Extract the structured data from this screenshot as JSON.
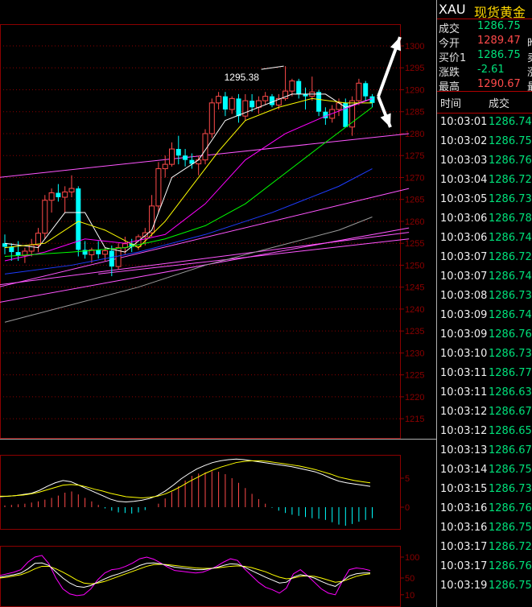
{
  "colors": {
    "background": "#000000",
    "grid": "#8b0000",
    "up": "#ff4a4a",
    "down": "#00ffff",
    "green_text": "#00e07a",
    "red_text": "#ff4a4a",
    "yellow_text": "#ffd700",
    "ma5": "#ffffff",
    "ma10": "#ffff00",
    "ma20": "#ff00ff",
    "ma30": "#00ff00",
    "ma60": "#1e3cff",
    "ma120": "#9a9a9a",
    "trend": "#ff55ff"
  },
  "header": {
    "symbol": "XAU",
    "name": "现货黄金"
  },
  "quote": [
    {
      "label": "成交",
      "value": "1286.75",
      "color": "#00e07a",
      "extra": ""
    },
    {
      "label": "今开",
      "value": "1289.47",
      "color": "#ff4a4a",
      "extra": "昨"
    },
    {
      "label": "买价1",
      "value": "1286.75",
      "color": "#00e07a",
      "extra": "卖"
    },
    {
      "label": "涨跌",
      "value": "-2.61",
      "color": "#00e07a",
      "extra": "涨"
    },
    {
      "label": "最高",
      "value": "1290.67",
      "color": "#ff4a4a",
      "extra": "最"
    }
  ],
  "ticks_header": {
    "time": "时间",
    "price": "成交"
  },
  "ticks": [
    {
      "time": "10:03:01",
      "price": "1286.74"
    },
    {
      "time": "10:03:02",
      "price": "1286.75"
    },
    {
      "time": "10:03:03",
      "price": "1286.76"
    },
    {
      "time": "10:03:04",
      "price": "1286.72"
    },
    {
      "time": "10:03:05",
      "price": "1286.73"
    },
    {
      "time": "10:03:06",
      "price": "1286.78"
    },
    {
      "time": "10:03:06",
      "price": "1286.74"
    },
    {
      "time": "10:03:07",
      "price": "1286.72"
    },
    {
      "time": "10:03:07",
      "price": "1286.74"
    },
    {
      "time": "10:03:08",
      "price": "1286.73"
    },
    {
      "time": "10:03:09",
      "price": "1286.74"
    },
    {
      "time": "10:03:09",
      "price": "1286.76"
    },
    {
      "time": "10:03:10",
      "price": "1286.73"
    },
    {
      "time": "10:03:11",
      "price": "1286.77"
    },
    {
      "time": "10:03:11",
      "price": "1286.63"
    },
    {
      "time": "10:03:12",
      "price": "1286.67"
    },
    {
      "time": "10:03:12",
      "price": "1286.65"
    },
    {
      "time": "10:03:13",
      "price": "1286.67"
    },
    {
      "time": "10:03:14",
      "price": "1286.75"
    },
    {
      "time": "10:03:15",
      "price": "1286.73"
    },
    {
      "time": "10:03:16",
      "price": "1286.76"
    },
    {
      "time": "10:03:16",
      "price": "1286.75"
    },
    {
      "time": "10:03:17",
      "price": "1286.72"
    },
    {
      "time": "10:03:17",
      "price": "1286.76"
    },
    {
      "time": "10:03:19",
      "price": "1286.75"
    }
  ],
  "chart_data": [
    {
      "type": "candlestick",
      "ylim": [
        1212,
        1302
      ],
      "y_ticks": [
        "1300",
        "1295",
        "1290",
        "1285",
        "1280",
        "1275",
        "1270",
        "1265",
        "1260",
        "1255",
        "1250",
        "1245",
        "1240",
        "1235",
        "1230",
        "1225",
        "1220",
        "1215"
      ],
      "annotation": "1295.38",
      "candles": [
        [
          1255.0,
          1257.0,
          1252.5,
          1254.2
        ],
        [
          1254.2,
          1255.0,
          1251.0,
          1253.0
        ],
        [
          1253.0,
          1255.5,
          1251.0,
          1252.2
        ],
        [
          1252.2,
          1254.0,
          1250.5,
          1253.2
        ],
        [
          1253.2,
          1256.0,
          1252.0,
          1254.6
        ],
        [
          1254.6,
          1258.5,
          1253.0,
          1257.3
        ],
        [
          1257.3,
          1266.0,
          1256.0,
          1264.8
        ],
        [
          1264.8,
          1267.5,
          1262.0,
          1266.5
        ],
        [
          1266.5,
          1268.5,
          1264.5,
          1265.5
        ],
        [
          1265.5,
          1268.0,
          1262.0,
          1266.7
        ],
        [
          1266.7,
          1270.5,
          1265.5,
          1267.5
        ],
        [
          1267.5,
          1268.0,
          1252.0,
          1253.5
        ],
        [
          1253.5,
          1255.5,
          1251.5,
          1252.4
        ],
        [
          1252.4,
          1254.0,
          1250.5,
          1253.5
        ],
        [
          1253.5,
          1255.5,
          1251.5,
          1252.5
        ],
        [
          1252.5,
          1254.0,
          1251.0,
          1253.3
        ],
        [
          1253.3,
          1254.5,
          1247.5,
          1249.7
        ],
        [
          1249.7,
          1255.0,
          1249.0,
          1254.0
        ],
        [
          1254.0,
          1256.5,
          1252.5,
          1254.9
        ],
        [
          1254.9,
          1256.0,
          1253.0,
          1254.2
        ],
        [
          1254.2,
          1257.0,
          1253.5,
          1256.5
        ],
        [
          1256.5,
          1258.5,
          1254.5,
          1257.4
        ],
        [
          1257.4,
          1266.0,
          1256.5,
          1263.5
        ],
        [
          1263.5,
          1273.5,
          1262.0,
          1272.0
        ],
        [
          1272.0,
          1275.0,
          1270.0,
          1273.0
        ],
        [
          1273.0,
          1278.0,
          1272.5,
          1276.5
        ],
        [
          1276.5,
          1279.5,
          1273.0,
          1275.0
        ],
        [
          1275.0,
          1276.5,
          1272.5,
          1274.0
        ],
        [
          1274.0,
          1275.5,
          1272.0,
          1273.1
        ],
        [
          1273.1,
          1275.0,
          1270.5,
          1274.0
        ],
        [
          1274.0,
          1281.0,
          1273.0,
          1280.0
        ],
        [
          1280.0,
          1288.0,
          1279.0,
          1287.0
        ],
        [
          1287.0,
          1289.5,
          1285.5,
          1288.5
        ],
        [
          1288.5,
          1289.5,
          1284.0,
          1285.5
        ],
        [
          1285.5,
          1288.5,
          1284.5,
          1288.0
        ],
        [
          1288.0,
          1289.0,
          1282.5,
          1284.0
        ],
        [
          1284.0,
          1289.0,
          1283.0,
          1287.5
        ],
        [
          1287.5,
          1289.0,
          1285.0,
          1286.0
        ],
        [
          1286.0,
          1288.5,
          1284.5,
          1287.5
        ],
        [
          1287.5,
          1289.5,
          1286.5,
          1288.5
        ],
        [
          1288.5,
          1289.0,
          1286.0,
          1286.5
        ],
        [
          1286.5,
          1289.0,
          1285.5,
          1288.0
        ],
        [
          1288.0,
          1295.38,
          1287.5,
          1289.7
        ],
        [
          1289.7,
          1292.5,
          1288.5,
          1292.0
        ],
        [
          1292.0,
          1292.5,
          1288.0,
          1289.0
        ],
        [
          1289.0,
          1290.5,
          1285.5,
          1288.5
        ],
        [
          1288.5,
          1293.0,
          1287.5,
          1289.5
        ],
        [
          1289.5,
          1290.0,
          1284.0,
          1285.0
        ],
        [
          1285.0,
          1286.0,
          1282.0,
          1283.5
        ],
        [
          1283.5,
          1286.5,
          1282.5,
          1285.5
        ],
        [
          1285.5,
          1288.0,
          1284.0,
          1287.0
        ],
        [
          1287.0,
          1288.0,
          1282.0,
          1281.5
        ],
        [
          1281.5,
          1288.5,
          1279.5,
          1287.5
        ],
        [
          1287.5,
          1292.5,
          1286.5,
          1291.5
        ],
        [
          1291.5,
          1292.0,
          1287.5,
          1288.5
        ],
        [
          1288.5,
          1289.0,
          1286.0,
          1287.0
        ]
      ],
      "moving_averages": [
        {
          "name": "ma5",
          "color": "#ffffff",
          "points": [
            [
              0,
              1255
            ],
            [
              5,
              1254
            ],
            [
              9,
              1262
            ],
            [
              12,
              1262
            ],
            [
              15,
              1254
            ],
            [
              18,
              1253
            ],
            [
              22,
              1258
            ],
            [
              25,
              1270
            ],
            [
              29,
              1274
            ],
            [
              33,
              1283
            ],
            [
              38,
              1286
            ],
            [
              43,
              1289
            ],
            [
              48,
              1289
            ],
            [
              51,
              1286
            ],
            [
              55,
              1288
            ]
          ]
        },
        {
          "name": "ma10",
          "color": "#ffff00",
          "points": [
            [
              0,
              1254
            ],
            [
              6,
              1255
            ],
            [
              11,
              1260
            ],
            [
              15,
              1258
            ],
            [
              20,
              1254
            ],
            [
              24,
              1260
            ],
            [
              28,
              1268
            ],
            [
              32,
              1276
            ],
            [
              36,
              1283
            ],
            [
              41,
              1286
            ],
            [
              46,
              1288
            ],
            [
              51,
              1287
            ],
            [
              55,
              1287
            ]
          ]
        },
        {
          "name": "ma20",
          "color": "#ff00ff",
          "points": [
            [
              0,
              1251
            ],
            [
              6,
              1253
            ],
            [
              12,
              1256
            ],
            [
              18,
              1255
            ],
            [
              24,
              1257
            ],
            [
              30,
              1264
            ],
            [
              36,
              1274
            ],
            [
              42,
              1280
            ],
            [
              48,
              1284
            ],
            [
              55,
              1288
            ]
          ]
        },
        {
          "name": "ma30",
          "color": "#00ff00",
          "points": [
            [
              0,
              1252
            ],
            [
              10,
              1253
            ],
            [
              18,
              1254
            ],
            [
              24,
              1256
            ],
            [
              30,
              1259
            ],
            [
              36,
              1264
            ],
            [
              42,
              1271
            ],
            [
              48,
              1278
            ],
            [
              55,
              1286
            ]
          ]
        },
        {
          "name": "ma60",
          "color": "#1e3cff",
          "points": [
            [
              0,
              1248
            ],
            [
              10,
              1250
            ],
            [
              20,
              1253
            ],
            [
              30,
              1257
            ],
            [
              40,
              1262
            ],
            [
              50,
              1268
            ],
            [
              55,
              1272
            ]
          ]
        },
        {
          "name": "ma120",
          "color": "#9a9a9a",
          "points": [
            [
              0,
              1237
            ],
            [
              10,
              1241
            ],
            [
              20,
              1245
            ],
            [
              30,
              1250
            ],
            [
              40,
              1254
            ],
            [
              50,
              1258
            ],
            [
              55,
              1261
            ]
          ]
        }
      ],
      "trendlines": [
        [
          [
            -1,
            1270
          ],
          [
            60.5,
            1280
          ]
        ],
        [
          [
            -1,
            1245
          ],
          [
            60.5,
            1267.5
          ]
        ],
        [
          [
            -1,
            1241.5
          ],
          [
            60.5,
            1258.5
          ]
        ],
        [
          [
            -1,
            1245.5
          ],
          [
            60.5,
            1257.5
          ]
        ],
        [
          [
            14,
            1248
          ],
          [
            60.5,
            1256
          ]
        ]
      ]
    },
    {
      "type": "macd",
      "ylim": [
        -3,
        8
      ],
      "y_ticks": [
        "5",
        "0"
      ],
      "hist": [
        0.3,
        0.4,
        0.5,
        0.6,
        0.8,
        1.0,
        1.3,
        1.6,
        2.0,
        2.5,
        2.7,
        2.2,
        1.6,
        1.0,
        0.4,
        -0.2,
        -0.6,
        -0.9,
        -1.0,
        -1.1,
        -0.9,
        -0.5,
        0.0,
        0.6,
        1.5,
        2.6,
        3.6,
        4.6,
        5.4,
        5.8,
        6.0,
        6.2,
        6.1,
        5.7,
        5.0,
        4.2,
        3.3,
        2.3,
        1.4,
        0.6,
        -0.1,
        -0.6,
        -1.0,
        -1.3,
        -1.5,
        -1.7,
        -1.9,
        -2.0,
        -2.2,
        -2.6,
        -3.0,
        -3.2,
        -2.9,
        -2.5,
        -2.2,
        -1.9
      ],
      "dif": [
        1.8,
        1.9,
        2.0,
        2.2,
        2.4,
        2.9,
        3.6,
        4.2,
        4.6,
        4.4,
        3.8,
        3.2,
        2.6,
        2.0,
        1.4,
        1.0,
        0.9,
        1.0,
        1.2,
        1.5,
        2.0,
        2.8,
        3.8,
        4.9,
        5.8,
        6.6,
        7.2,
        7.7,
        8.0,
        8.2,
        8.3,
        8.2,
        8.0,
        7.8,
        7.6,
        7.4,
        7.2,
        7.0,
        6.7,
        6.4,
        6.1,
        5.6,
        5.0,
        4.5,
        4.2,
        4.0,
        3.8,
        3.6
      ],
      "dea": [
        1.9,
        1.9,
        2.0,
        2.1,
        2.3,
        2.6,
        3.0,
        3.4,
        3.8,
        3.9,
        3.8,
        3.5,
        3.1,
        2.8,
        2.4,
        2.1,
        1.8,
        1.7,
        1.6,
        1.7,
        1.9,
        2.3,
        2.9,
        3.6,
        4.4,
        5.1,
        5.8,
        6.4,
        6.9,
        7.3,
        7.7,
        7.9,
        8.0,
        8.0,
        7.9,
        7.7,
        7.5,
        7.3,
        7.1,
        6.8,
        6.5,
        6.1,
        5.7,
        5.2,
        4.9,
        4.6,
        4.4,
        4.2
      ]
    },
    {
      "type": "kdj",
      "ylim": [
        5,
        105
      ],
      "y_ticks": [
        "100",
        "50",
        "10"
      ],
      "k": [
        52,
        55,
        58,
        62,
        72,
        85,
        86,
        80,
        65,
        50,
        38,
        30,
        28,
        32,
        40,
        48,
        55,
        60,
        66,
        72,
        80,
        85,
        86,
        84,
        80,
        76,
        74,
        72,
        70,
        70,
        72,
        75,
        80,
        84,
        83,
        76,
        68,
        60,
        52,
        45,
        38,
        40,
        52,
        58,
        55,
        50,
        42,
        35,
        30,
        42,
        55,
        60,
        62,
        62
      ],
      "d": [
        50,
        52,
        55,
        58,
        64,
        72,
        78,
        78,
        72,
        64,
        55,
        45,
        38,
        36,
        38,
        42,
        48,
        54,
        60,
        66,
        72,
        78,
        82,
        83,
        82,
        80,
        78,
        76,
        74,
        73,
        73,
        74,
        76,
        78,
        79,
        78,
        75,
        70,
        65,
        58,
        52,
        48,
        50,
        54,
        55,
        54,
        50,
        45,
        40,
        42,
        48,
        54,
        58,
        60
      ],
      "j": [
        56,
        60,
        64,
        70,
        88,
        100,
        104,
        84,
        50,
        24,
        12,
        8,
        10,
        24,
        46,
        62,
        70,
        72,
        78,
        86,
        96,
        100,
        95,
        86,
        76,
        68,
        66,
        64,
        62,
        64,
        70,
        78,
        88,
        96,
        92,
        72,
        56,
        40,
        28,
        22,
        14,
        26,
        60,
        70,
        56,
        40,
        24,
        14,
        10,
        42,
        70,
        74,
        72,
        68
      ]
    }
  ]
}
